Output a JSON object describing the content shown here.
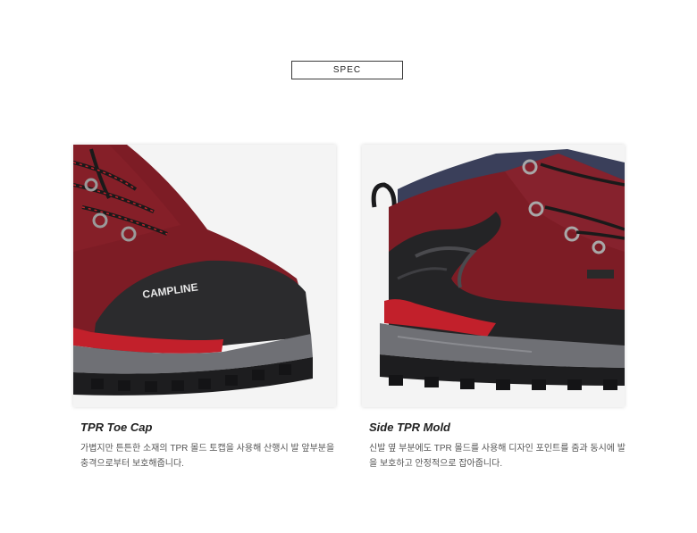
{
  "header": {
    "badge_label": "SPEC"
  },
  "features": [
    {
      "title": "TPR Toe Cap",
      "description": "가볍지만 튼튼한 소재의 TPR 몰드 토캡을 사용해 산행시 발 앞부분을 충격으로부터 보호해줍니다.",
      "image": "toe-cap-closeup",
      "brand_text": "CAMPLINE"
    },
    {
      "title": "Side TPR Mold",
      "description": "신발 옆 부분에도 TPR 몰드를 사용해 디자인 포인트를 줌과 동시에 발을 보호하고 안정적으로 잡아줍니다.",
      "image": "side-mold-closeup"
    }
  ],
  "colors": {
    "leather": "#7d1c25",
    "rubber": "#2b2b2d",
    "accent_red": "#c2202b",
    "midsole": "#6f7075"
  }
}
